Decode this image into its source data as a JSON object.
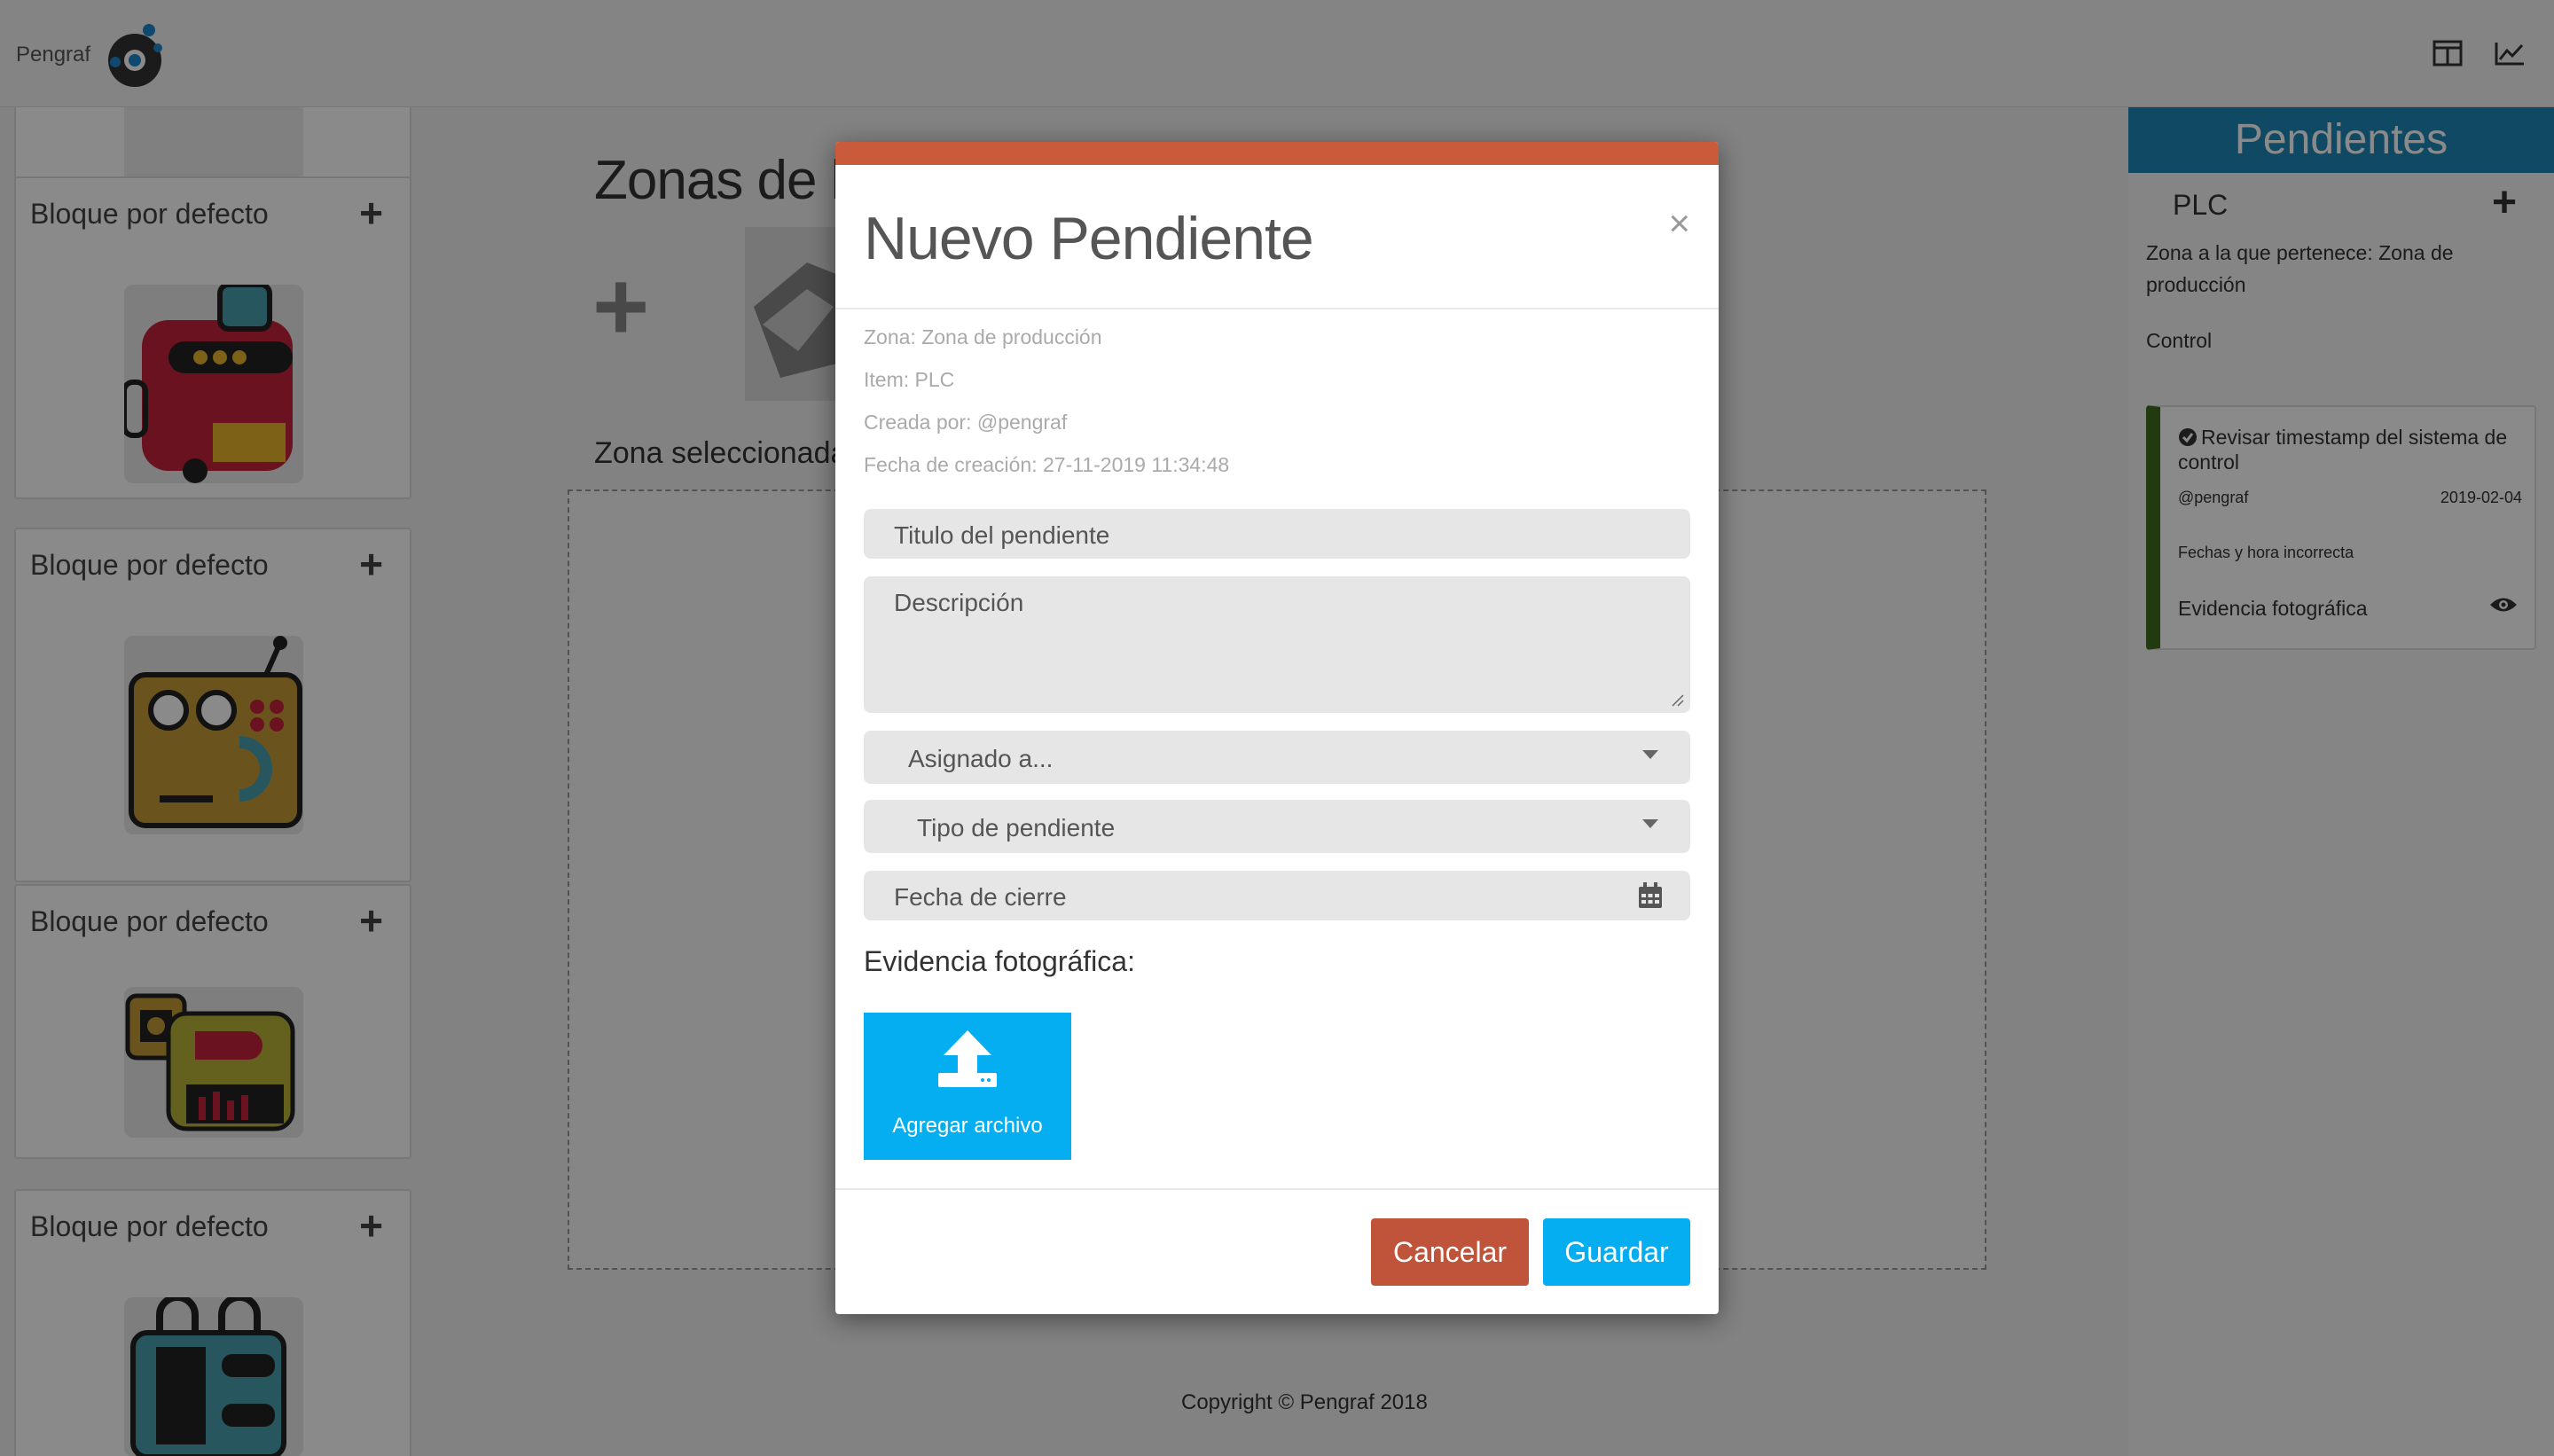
{
  "app": {
    "logo_text": "Pengraf",
    "zones_title": "Zonas de la",
    "zone_selected": "Zona seleccionada: Z",
    "copyright": "Copyright © Pengraf 2018"
  },
  "left_panel": {
    "blocks": [
      {
        "title": "Bloque por defecto"
      },
      {
        "title": "Bloque por defecto"
      },
      {
        "title": "Bloque por defecto"
      },
      {
        "title": "Bloque por defecto"
      }
    ]
  },
  "right_panel": {
    "header": "Pendientes",
    "item": "PLC",
    "zone_text": "Zona a la que pertenece: Zona de producción",
    "control": "Control",
    "card": {
      "title": "Revisar timestamp del sistema de control",
      "user": "@pengraf",
      "date": "2019-02-04",
      "description": "Fechas y hora incorrecta",
      "evidence": "Evidencia fotográfica",
      "accent_color": "#3d6b1f"
    }
  },
  "modal": {
    "title": "Nuevo Pendiente",
    "close": "×",
    "meta": {
      "zona": "Zona: Zona de producción",
      "item": "Item: PLC",
      "creada": "Creada por: @pengraf",
      "fecha": "Fecha de creación: 27-11-2019 11:34:48"
    },
    "fields": {
      "titulo_placeholder": "Titulo del pendiente",
      "descripcion_placeholder": "Descripción",
      "asignado": "Asignado a...",
      "tipo": "Tipo de pendiente",
      "fecha_cierre": "Fecha de cierre"
    },
    "evidence_label": "Evidencia fotográfica:",
    "upload_label": "Agregar archivo",
    "cancel": "Cancelar",
    "save": "Guardar",
    "colors": {
      "top_bar": "#c95a3a",
      "cancel": "#c0543a",
      "primary": "#04aef0"
    }
  }
}
